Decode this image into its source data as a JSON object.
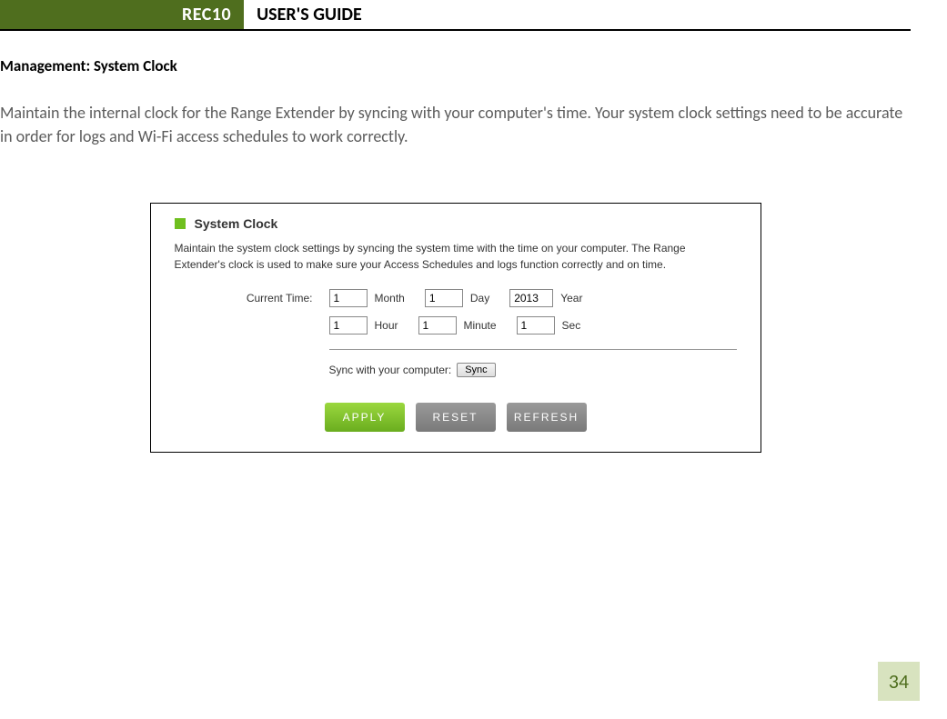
{
  "header": {
    "product": "REC10",
    "title": "USER'S GUIDE"
  },
  "section": {
    "heading": "Management: System Clock",
    "intro": "Maintain the internal clock for the Range Extender by syncing with your computer's time. Your system clock settings need to be accurate in order for logs and Wi-Fi access schedules to work correctly."
  },
  "panel": {
    "title": "System Clock",
    "desc": "Maintain the system clock settings by syncing the system time with the time on your computer. The Range Extender's clock is used to make sure your Access Schedules and logs function correctly and on time.",
    "current_time_label": "Current Time:",
    "month_value": "1",
    "month_label": "Month",
    "day_value": "1",
    "day_label": "Day",
    "year_value": "2013",
    "year_label": "Year",
    "hour_value": "1",
    "hour_label": "Hour",
    "minute_value": "1",
    "minute_label": "Minute",
    "sec_value": "1",
    "sec_label": "Sec",
    "sync_label": "Sync with your computer:",
    "sync_button": "Sync",
    "apply": "APPLY",
    "reset": "RESET",
    "refresh": "REFRESH"
  },
  "page_number": "34"
}
